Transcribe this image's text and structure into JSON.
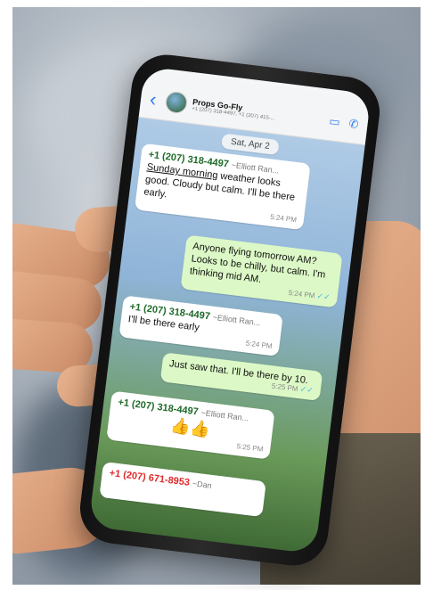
{
  "chat": {
    "group_name": "Props Go-Fly",
    "group_members": "+1 (207) 318-4497, +1 (207) 415-...",
    "date_label": "Sat, Apr 2",
    "messages": [
      {
        "direction": "in",
        "sender_number": "+1 (207) 318-4497",
        "sender_name": "~Elliott Ran...",
        "text_underlined": "Sunday morning",
        "text": "weather looks good. Cloudy but calm. I'll be there early.",
        "time": "5:24 PM"
      },
      {
        "direction": "out",
        "text": "Anyone flying tomorrow AM? Looks to be chilly, but calm. I'm thinking mid AM.",
        "time": "5:24 PM",
        "ticks": "✓✓"
      },
      {
        "direction": "in",
        "sender_number": "+1 (207) 318-4497",
        "sender_name": "~Elliott Ran...",
        "text": "I'll be there early",
        "time": "5:24 PM"
      },
      {
        "direction": "out",
        "text": "Just saw that. I'll be there by 10.",
        "time": "5:25 PM",
        "ticks": "✓✓"
      },
      {
        "direction": "in",
        "sender_number": "+1 (207) 318-4497",
        "sender_name": "~Elliott Ran...",
        "text": "👍👍",
        "time": "5:25 PM"
      },
      {
        "direction": "in",
        "sender_number": "+1 (207) 671-8953",
        "sender_name": "~Dan"
      }
    ]
  },
  "icons": {
    "back": "‹",
    "video": "▭",
    "phone": "✆"
  },
  "colors": {
    "accent": "#2f7cf6",
    "outgoing_bubble": "#dcf8c6",
    "sender_green": "#1f6b2a",
    "sender_red": "#e02b2b"
  }
}
